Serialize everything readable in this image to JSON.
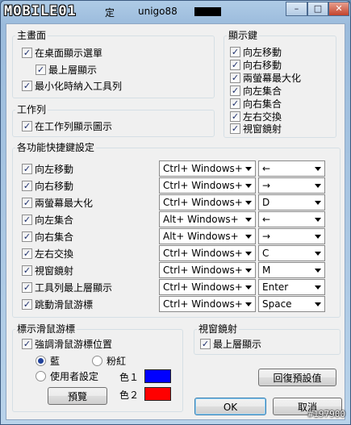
{
  "titlebar": {
    "logo_text": "MOBILE01",
    "title_suffix": "定",
    "user": "unigo88",
    "minimize": "–",
    "maximize": "□",
    "close": "✕"
  },
  "main_group": {
    "label": "主畫面",
    "items": [
      {
        "label": "在桌面顯示選單",
        "checked": true
      },
      {
        "label": "最上層顯示",
        "checked": true
      },
      {
        "label": "最小化時納入工具列",
        "checked": true
      }
    ]
  },
  "taskbar_group": {
    "label": "工作列",
    "items": [
      {
        "label": "在工作列顯示圖示",
        "checked": true
      }
    ]
  },
  "display_keys_group": {
    "label": "顯示鍵",
    "items": [
      {
        "label": "向左移動",
        "checked": true
      },
      {
        "label": "向右移動",
        "checked": true
      },
      {
        "label": "兩螢幕最大化",
        "checked": true
      },
      {
        "label": "向左集合",
        "checked": true
      },
      {
        "label": "向右集合",
        "checked": true
      },
      {
        "label": "左右交換",
        "checked": true
      },
      {
        "label": "視窗鏡射",
        "checked": true
      }
    ]
  },
  "hotkeys_group": {
    "label": "各功能快捷鍵設定",
    "rows": [
      {
        "label": "向左移動",
        "modifier": "Ctrl+ Windows+",
        "key": "←"
      },
      {
        "label": "向右移動",
        "modifier": "Ctrl+ Windows+",
        "key": "→"
      },
      {
        "label": "兩螢幕最大化",
        "modifier": "Ctrl+ Windows+",
        "key": "D"
      },
      {
        "label": "向左集合",
        "modifier": "Alt+ Windows+",
        "key": "←"
      },
      {
        "label": "向右集合",
        "modifier": "Alt+ Windows+",
        "key": "→"
      },
      {
        "label": "左右交換",
        "modifier": "Ctrl+ Windows+",
        "key": "C"
      },
      {
        "label": "視窗鏡射",
        "modifier": "Ctrl+ Windows+",
        "key": "M"
      },
      {
        "label": "工具列最上層顯示",
        "modifier": "Ctrl+ Windows+",
        "key": "Enter"
      },
      {
        "label": "跳動滑鼠游標",
        "modifier": "Ctrl+ Windows+",
        "key": "Space"
      }
    ]
  },
  "mouse_group": {
    "label": "標示滑鼠游標",
    "highlight_label": "強調滑鼠游標位置",
    "radio_blue": "藍",
    "radio_pink": "粉紅",
    "radio_custom": "使用者設定",
    "color1_label": "色１",
    "color2_label": "色２",
    "color1": "#0000ff",
    "color2": "#ff0000",
    "preview_button": "預覽"
  },
  "mirror_group": {
    "label": "視窗鏡射",
    "topmost_label": "最上層顯示"
  },
  "buttons": {
    "restore_defaults": "回復預設值",
    "ok": "OK",
    "cancel": "取消"
  },
  "watermark": "#197900"
}
